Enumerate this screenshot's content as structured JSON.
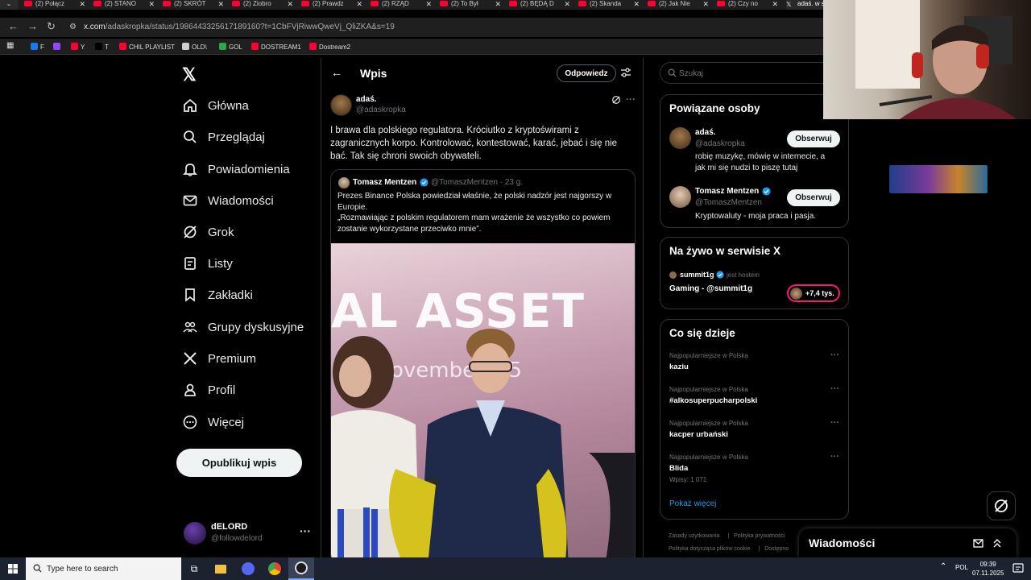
{
  "browser": {
    "tabs": [
      {
        "label": "(2) Połącz"
      },
      {
        "label": "(2) STANO"
      },
      {
        "label": "(2) SKRÓT"
      },
      {
        "label": "(2) Ziobro"
      },
      {
        "label": "(2) Prawdz"
      },
      {
        "label": "(2) RZĄD "
      },
      {
        "label": "(2) To Był"
      },
      {
        "label": "(2) BĘDĄ D"
      },
      {
        "label": "(2) Skanda"
      },
      {
        "label": "(2) Jak Nie"
      },
      {
        "label": "(2) Czy no"
      },
      {
        "label": "adaś. w s"
      }
    ],
    "url_main": "x.com",
    "url_path": "/adaskropka/status/1986443325617189160?t=1CbFVjRiwwQweVj_QliZKA&s=19",
    "bookmarks": [
      {
        "label": "F",
        "color": "#1877f2"
      },
      {
        "label": "",
        "color": "#9146ff"
      },
      {
        "label": "Y",
        "color": "#ff0033"
      },
      {
        "label": "T",
        "color": "#000000"
      },
      {
        "label": "CHIL PLAYLIST",
        "color": "#ff0033"
      },
      {
        "label": "OLD\\",
        "color": "#cfcfcf"
      },
      {
        "label": "GOL",
        "color": "#2ba84a"
      },
      {
        "label": "DOSTREAM1",
        "color": "#ff0033"
      },
      {
        "label": "Dostream2",
        "color": "#ff0033"
      }
    ]
  },
  "nav": {
    "items": [
      {
        "label": "Główna",
        "icon": "home-icon"
      },
      {
        "label": "Przeglądaj",
        "icon": "search-icon"
      },
      {
        "label": "Powiadomienia",
        "icon": "bell-icon"
      },
      {
        "label": "Wiadomości",
        "icon": "mail-icon"
      },
      {
        "label": "Grok",
        "icon": "grok-icon"
      },
      {
        "label": "Listy",
        "icon": "list-icon"
      },
      {
        "label": "Zakładki",
        "icon": "bookmark-icon"
      },
      {
        "label": "Grupy dyskusyjne",
        "icon": "communities-icon"
      },
      {
        "label": "Premium",
        "icon": "x-icon"
      },
      {
        "label": "Profil",
        "icon": "person-icon"
      },
      {
        "label": "Więcej",
        "icon": "more-circle-icon"
      }
    ],
    "post_button": "Opublikuj wpis",
    "account": {
      "name": "dELORD",
      "handle": "@followdelord"
    }
  },
  "main": {
    "title": "Wpis",
    "reply_button": "Odpowiedz",
    "post": {
      "author_name": "adaś.",
      "author_handle": "@adaskropka",
      "text": "I brawa dla polskiego regulatora. Króciutko z kryptoświrami z zagranicznych korpo. Kontrolować, kontestować, karać, jebać i się nie bać. Tak się chroni swoich obywateli."
    },
    "quote": {
      "author_name": "Tomasz Mentzen",
      "author_handle": "@TomaszMentzen · 23 g.",
      "text_line1": "Prezes Binance Polska powiedział właśnie, że polski nadzór jest najgorszy w Europie.",
      "text_line2": "„Rozmawiając z polskim regulatorem mam wrażenie że wszystko co powiem zostanie wykorzystane przeciwko mnie”.",
      "photo_banner": "AL ASSET",
      "photo_sub": "ovembe  025"
    }
  },
  "right": {
    "search_placeholder": "Szukaj",
    "related": {
      "title": "Powiązane osoby",
      "people": [
        {
          "name": "adaś.",
          "handle": "@adaskropka",
          "bio": "robię muzykę, mówię w internecie, a jak mi się nudzi to piszę tutaj",
          "follow": "Obserwuj"
        },
        {
          "name": "Tomasz Mentzen",
          "handle": "@TomaszMentzen",
          "bio": "Kryptowaluty - moja praca i pasja.",
          "follow": "Obserwuj"
        }
      ]
    },
    "live": {
      "title": "Na żywo w serwisie X",
      "host": "summit1g",
      "host_suffix": "jest hostem",
      "stream": "Gaming - @summit1g",
      "listeners": "+7,4 tys."
    },
    "trends": {
      "title": "Co się dzieje",
      "items": [
        {
          "category": "Najpopularniejsze w Polska",
          "name": "kaziu",
          "count": ""
        },
        {
          "category": "Najpopularniejsze w Polska",
          "name": "#alkosuperpucharpolski",
          "count": ""
        },
        {
          "category": "Najpopularniejsze w Polska",
          "name": "kacper urbański",
          "count": ""
        },
        {
          "category": "Najpopularniejsze w Polska",
          "name": "Blida",
          "count": "Wpisy: 1 071"
        }
      ],
      "show_more": "Pokaż więcej"
    },
    "footer": [
      "Zasady użytkowania",
      "Polityka prywatności",
      "Polityka dotycząca plików cookie",
      "Dostępno"
    ],
    "messages": "Wiadomości"
  },
  "taskbar": {
    "search_placeholder": "Type here to search",
    "lang": "POL",
    "time": "09:39",
    "date": "07.11.2025"
  },
  "colors": {
    "accent": "#1d9bf0",
    "background": "#000000",
    "border": "#2f3336",
    "live_ring": "#f91880"
  }
}
